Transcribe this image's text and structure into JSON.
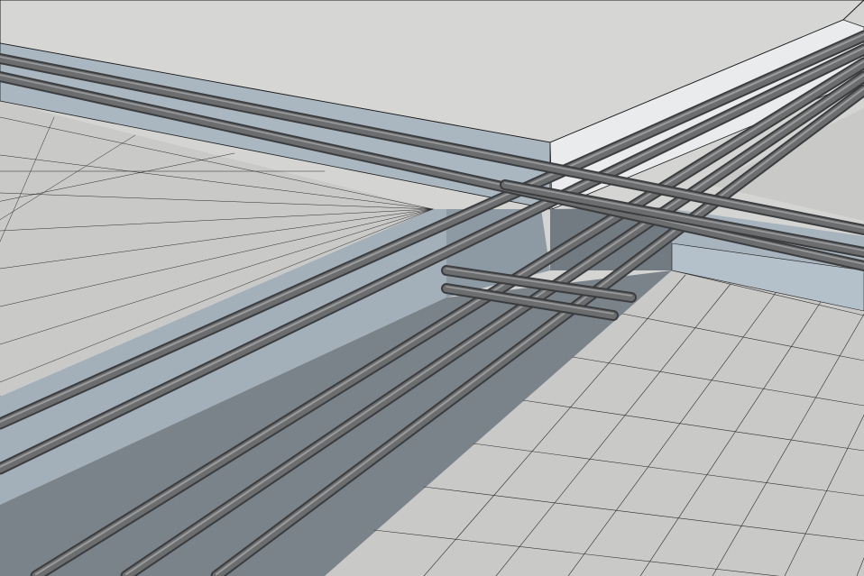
{
  "scene": {
    "subject": "rebar-grid-trench-intersection",
    "colors": {
      "slab_top": "#d6d7d4",
      "floor": "#c8c9c7",
      "wall_light": "#a9b6c0",
      "wall_shadow": "#8e9aa4",
      "wall_dark": "#727980",
      "rebar": "#6b6c6e",
      "rebar_highlight": "#9a9b9d",
      "edge": "#1a1a1a",
      "grid_line": "#2a2a2a"
    }
  }
}
